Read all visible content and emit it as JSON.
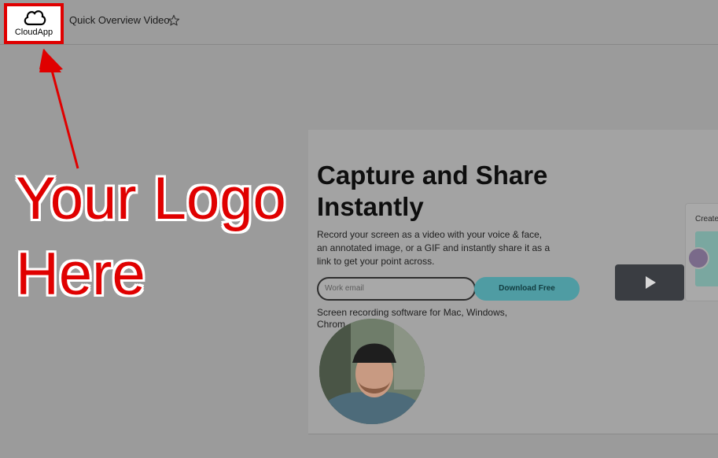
{
  "header": {
    "logo_text": "CloudApp",
    "video_title": "Quick Overview Video"
  },
  "annotation": {
    "line1": "Your Logo",
    "line2": "Here"
  },
  "video": {
    "hero_title_1": "Capture and Share",
    "hero_title_2": "Instantly",
    "description": "Record your screen as a video with your voice & face, an annotated image, or a GIF and instantly share it as a link to get your point across.",
    "email_placeholder": "Work email",
    "download_label": "Download Free",
    "sub_text": "Screen recording software for Mac, Windows, Chrom",
    "side_card_title": "Create"
  },
  "colors": {
    "annotation_red": "#e00000",
    "button_teal": "#4f9ca3",
    "background_gray": "#9b9b9b"
  },
  "icons": {
    "logo": "cloud-icon",
    "favorite": "star-outline-icon",
    "play": "play-icon"
  }
}
